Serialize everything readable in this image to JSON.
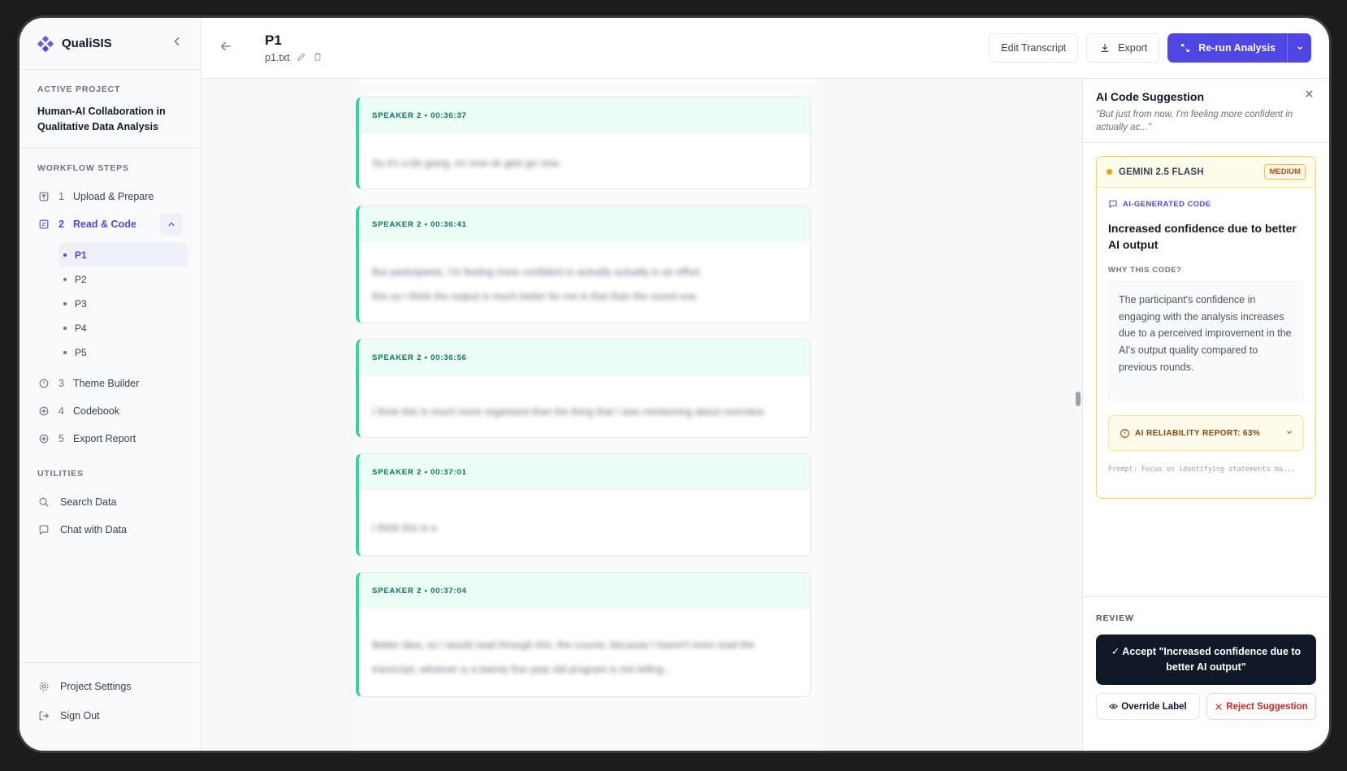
{
  "app": {
    "name": "QualiSIS"
  },
  "sidebar": {
    "active_project_label": "ACTIVE PROJECT",
    "project_name": "Human-AI Collaboration in Qualitative Data Analysis",
    "workflow_label": "WORKFLOW STEPS",
    "steps": [
      {
        "num": "1",
        "label": "Upload & Prepare",
        "icon": "upload-icon"
      },
      {
        "num": "2",
        "label": "Read & Code",
        "icon": "document-icon"
      },
      {
        "num": "3",
        "label": "Theme Builder",
        "icon": "theme-icon"
      },
      {
        "num": "4",
        "label": "Codebook",
        "icon": "codebook-icon"
      },
      {
        "num": "5",
        "label": "Export Report",
        "icon": "export-report-icon"
      }
    ],
    "participants": [
      "P1",
      "P2",
      "P3",
      "P4",
      "P5"
    ],
    "utilities_label": "UTILITIES",
    "utilities": [
      {
        "label": "Search Data",
        "icon": "search-icon"
      },
      {
        "label": "Chat with Data",
        "icon": "chat-icon"
      }
    ],
    "bottom": [
      {
        "label": "Project Settings",
        "icon": "gear-icon"
      },
      {
        "label": "Sign Out",
        "icon": "sign-out-icon"
      }
    ]
  },
  "header": {
    "title": "P1",
    "file_name": "p1.txt",
    "edit_transcript": "Edit Transcript",
    "export": "Export",
    "rerun": "Re-run Analysis"
  },
  "transcript": {
    "utterances": [
      {
        "meta": "SPEAKER 2 • 00:36:37",
        "lines": [
          "So it's a bit going, on now ok gets go now."
        ]
      },
      {
        "meta": "SPEAKER 2 • 00:36:41",
        "lines": [
          "But participants, I'm feeling more confident in actually actually in an effort.",
          "this so I think the output is much better for me in that than the round one."
        ]
      },
      {
        "meta": "SPEAKER 2 • 00:36:56",
        "lines": [
          "I think this is much more organized than the thing that I was mentioning about overview."
        ]
      },
      {
        "meta": "SPEAKER 2 • 00:37:01",
        "lines": [
          "I think this is a"
        ]
      },
      {
        "meta": "SPEAKER 2 • 00:37:04",
        "lines": [
          "Better idea, so I would read through this, the course, because I haven't even read the",
          "transcript, whoever is a twenty five year old program is not telling..."
        ]
      }
    ]
  },
  "panel": {
    "title": "AI Code Suggestion",
    "quote": "\"But just from now, I'm feeling more confident in actually ac...\"",
    "model": "GEMINI 2.5 FLASH",
    "confidence_badge": "MEDIUM",
    "ai_generated_label": "AI-GENERATED CODE",
    "code_title": "Increased confidence due to better AI output",
    "why_label": "WHY THIS CODE?",
    "reason": "The participant's confidence in engaging with the analysis increases due to a perceived improvement in the AI's output quality compared to previous rounds.",
    "reliability": "AI RELIABILITY REPORT: 63%",
    "prompt": "Prompt: Focus on identifying statements ma...",
    "review_label": "REVIEW",
    "accept": "✓ Accept \"Increased confidence due to better AI output\"",
    "override": "Override Label",
    "reject": "Reject Suggestion"
  },
  "colors": {
    "accent": "#4f46e5",
    "utterance_border": "#34d399",
    "utterance_header": "#ecfdf5",
    "warning": "#f59e0b",
    "danger": "#dc2626"
  }
}
